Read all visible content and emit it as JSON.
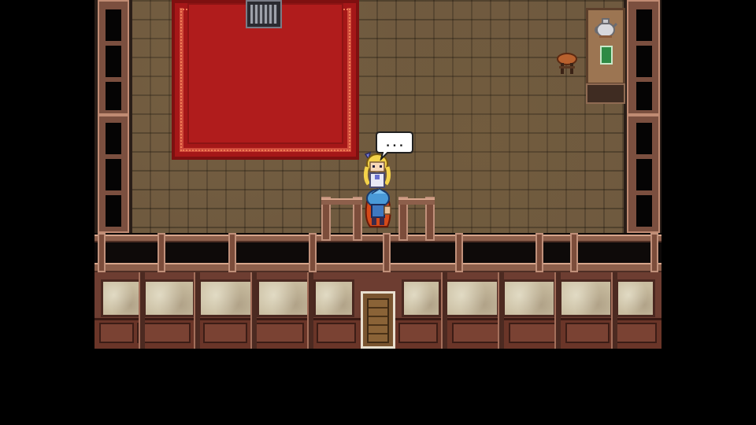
{
  "scene": {
    "location": "manor-room",
    "characters": [
      {
        "id": "girl",
        "sprite": "blonde-girl-with-headband"
      },
      {
        "id": "hero",
        "sprite": "blue-haired-hero-red-cape"
      }
    ],
    "speech_bubble_text": "...",
    "objects": [
      "red-rug",
      "iron-grate",
      "side-table",
      "teapot",
      "green-book",
      "wooden-stool",
      "wooden-door",
      "railing"
    ]
  },
  "colors": {
    "floor": "#6f5a3f",
    "rug": "#a51718",
    "wall_wood": "#6d3d31",
    "panel": "#c9bda0",
    "letterbox": "#000000"
  }
}
